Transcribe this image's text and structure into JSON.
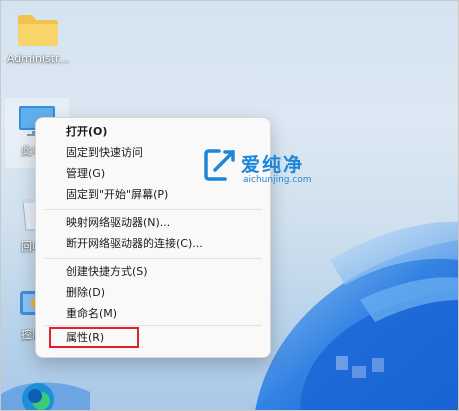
{
  "desktop": {
    "icons": [
      {
        "name": "folder-icon",
        "label": "Administr..."
      },
      {
        "name": "this-pc-icon",
        "label": "此电"
      },
      {
        "name": "recycle-bin-icon",
        "label": "回收"
      },
      {
        "name": "control-panel-icon",
        "label": "控制"
      },
      {
        "name": "edge-icon",
        "label": ""
      }
    ]
  },
  "context_menu": {
    "items": [
      {
        "label": "打开(O)",
        "bold": true
      },
      {
        "label": "固定到快速访问"
      },
      {
        "label": "管理(G)"
      },
      {
        "label": "固定到\"开始\"屏幕(P)"
      },
      {
        "label": "映射网络驱动器(N)..."
      },
      {
        "label": "断开网络驱动器的连接(C)..."
      },
      {
        "label": "创建快捷方式(S)"
      },
      {
        "label": "删除(D)"
      },
      {
        "label": "重命名(M)"
      },
      {
        "label": "属性(R)",
        "highlighted": true
      }
    ],
    "highlight_color": "#e0202a"
  },
  "watermark": {
    "brand": "爱纯净",
    "url": "aichunjing.com",
    "color": "#1e86d8"
  }
}
